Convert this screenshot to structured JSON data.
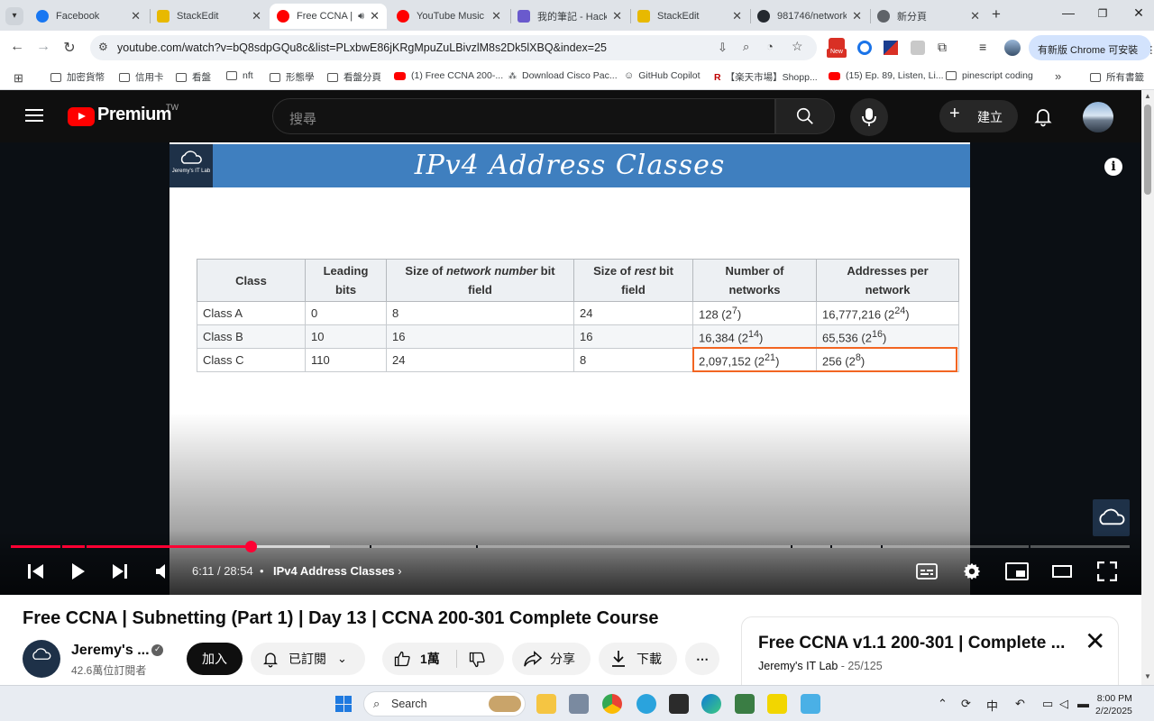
{
  "tabs": [
    {
      "title": "Facebook",
      "favicon_color": "#1877f2"
    },
    {
      "title": "StackEdit",
      "favicon_color": "#e8b900"
    },
    {
      "title": "Free CCNA |",
      "favicon_color": "#ff0000",
      "active": true,
      "audio_icon": "speaker-icon"
    },
    {
      "title": "YouTube Music",
      "favicon_color": "#ff0000"
    },
    {
      "title": "我的筆記 - HackM",
      "favicon_color": "#6a5acd"
    },
    {
      "title": "StackEdit",
      "favicon_color": "#e8b900"
    },
    {
      "title": "981746/network",
      "favicon_color": "#24292f"
    },
    {
      "title": "新分頁",
      "favicon_color": "#5f6368"
    }
  ],
  "browser": {
    "url": "youtube.com/watch?v=bQ8sdpGQu8c&list=PLxbwE86jKRgMpuZuLBivzlM8s2Dk5lXBQ&index=25",
    "update_button": "有新版 Chrome 可安裝",
    "new_badge": "New"
  },
  "bookmarks": [
    {
      "label": "加密貨幣",
      "kind": "folder"
    },
    {
      "label": "信用卡",
      "kind": "folder"
    },
    {
      "label": "看盤",
      "kind": "folder"
    },
    {
      "label": "nft",
      "kind": "folder"
    },
    {
      "label": "形態學",
      "kind": "folder"
    },
    {
      "label": "看盤分頁",
      "kind": "folder"
    },
    {
      "label": "(1) Free CCNA 200-...",
      "kind": "youtube"
    },
    {
      "label": "Download Cisco Pac...",
      "kind": "site"
    },
    {
      "label": "GitHub Copilot",
      "kind": "site"
    },
    {
      "label": "【楽天市場】Shopp...",
      "kind": "rakuten"
    },
    {
      "label": "(15) Ep. 89, Listen, Li...",
      "kind": "youtube"
    },
    {
      "label": "pinescript coding",
      "kind": "folder"
    },
    {
      "label": "所有書籤",
      "kind": "folder"
    }
  ],
  "youtube": {
    "logo_text": "Premium",
    "region": "TW",
    "search_placeholder": "搜尋",
    "create_label": "建立"
  },
  "slide": {
    "logo_text": "Jeremy's IT Lab",
    "title": "IPv4 Address Classes",
    "table": {
      "headers": [
        [
          "Class"
        ],
        [
          "Leading",
          "bits"
        ],
        [
          "Size of ",
          "network number",
          " bit",
          "field"
        ],
        [
          "Size of ",
          "rest",
          " bit",
          "field"
        ],
        [
          "Number of",
          "networks"
        ],
        [
          "Addresses per",
          "network"
        ]
      ],
      "rows": [
        {
          "cls": "Class A",
          "leading": "0",
          "net_bits": "8",
          "rest_bits": "24",
          "networks": "128 (2",
          "networks_exp": "7",
          "addresses": "16,777,216 (2",
          "addresses_exp": "24"
        },
        {
          "cls": "Class B",
          "leading": "10",
          "net_bits": "16",
          "rest_bits": "16",
          "networks": "16,384 (2",
          "networks_exp": "14",
          "addresses": "65,536 (2",
          "addresses_exp": "16"
        },
        {
          "cls": "Class C",
          "leading": "110",
          "net_bits": "24",
          "rest_bits": "8",
          "networks": "2,097,152 (2",
          "networks_exp": "21",
          "addresses": "256 (2",
          "addresses_exp": "8"
        }
      ],
      "close_paren": ")"
    },
    "highlight_color": "#f26522"
  },
  "player": {
    "time_current": "6:11",
    "time_total": "28:54",
    "chapter": "IPv4 Address Classes",
    "progress_played": 0.214,
    "progress_buffered": 0.285
  },
  "video": {
    "title": "Free CCNA | Subnetting (Part 1) | Day 13 | CCNA 200-301 Complete Course",
    "channel": "Jeremy's ...",
    "subscribers": "42.6萬位訂閱者",
    "join_label": "加入",
    "subscribed_label": "已訂閱",
    "likes": "1萬",
    "share_label": "分享",
    "download_label": "下載"
  },
  "playlist": {
    "title": "Free CCNA v1.1 200-301 | Complete ...",
    "owner": "Jeremy's IT Lab",
    "position": "25/125"
  },
  "taskbar": {
    "search_label": "Search",
    "ime": "中",
    "time": "8:00 PM",
    "date": "2/2/2025"
  }
}
